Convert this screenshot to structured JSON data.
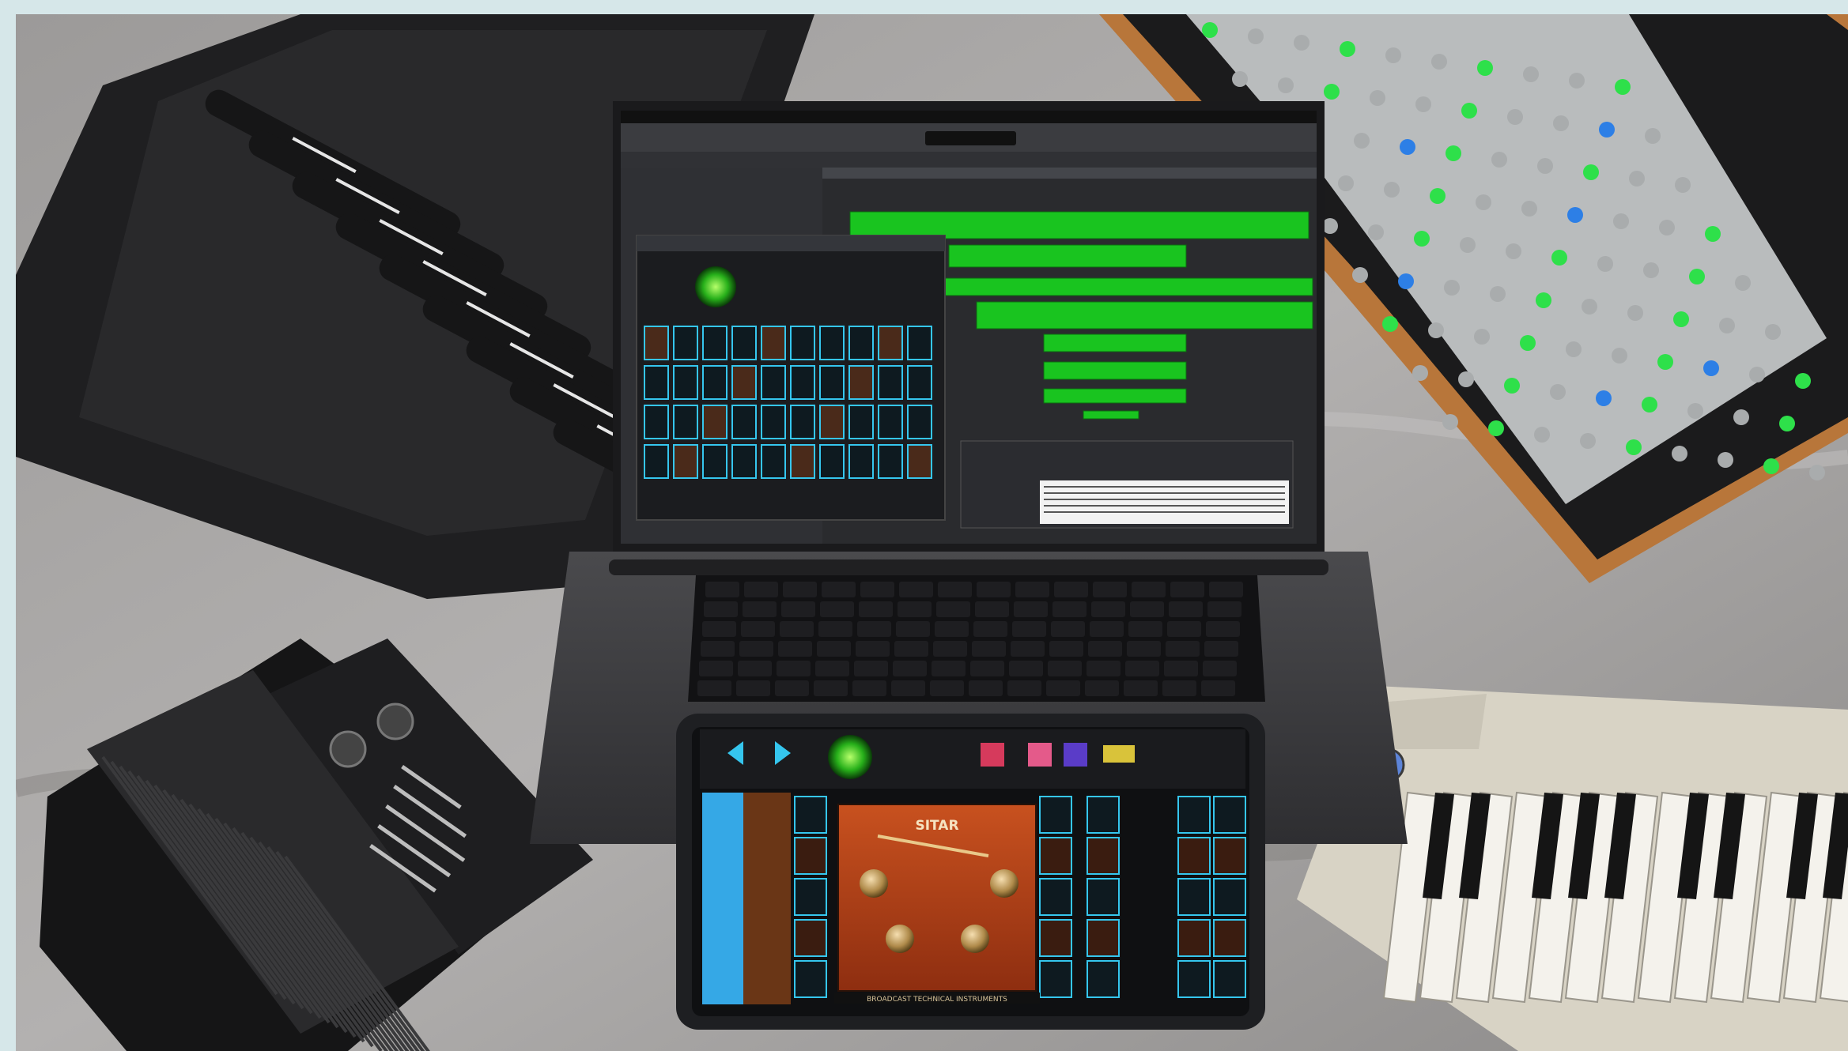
{
  "ipad": {
    "instrument_name": "SITAR",
    "footer_brand": "BROADCAST TECHNICAL INSTRUMENTS"
  },
  "colors": {
    "daw_green": "#19c41f",
    "pad_green": "#2ee04a",
    "pad_blue": "#2d7fe6",
    "cyan_accent": "#35c6ee",
    "sitar_panel": "#c0461f"
  }
}
